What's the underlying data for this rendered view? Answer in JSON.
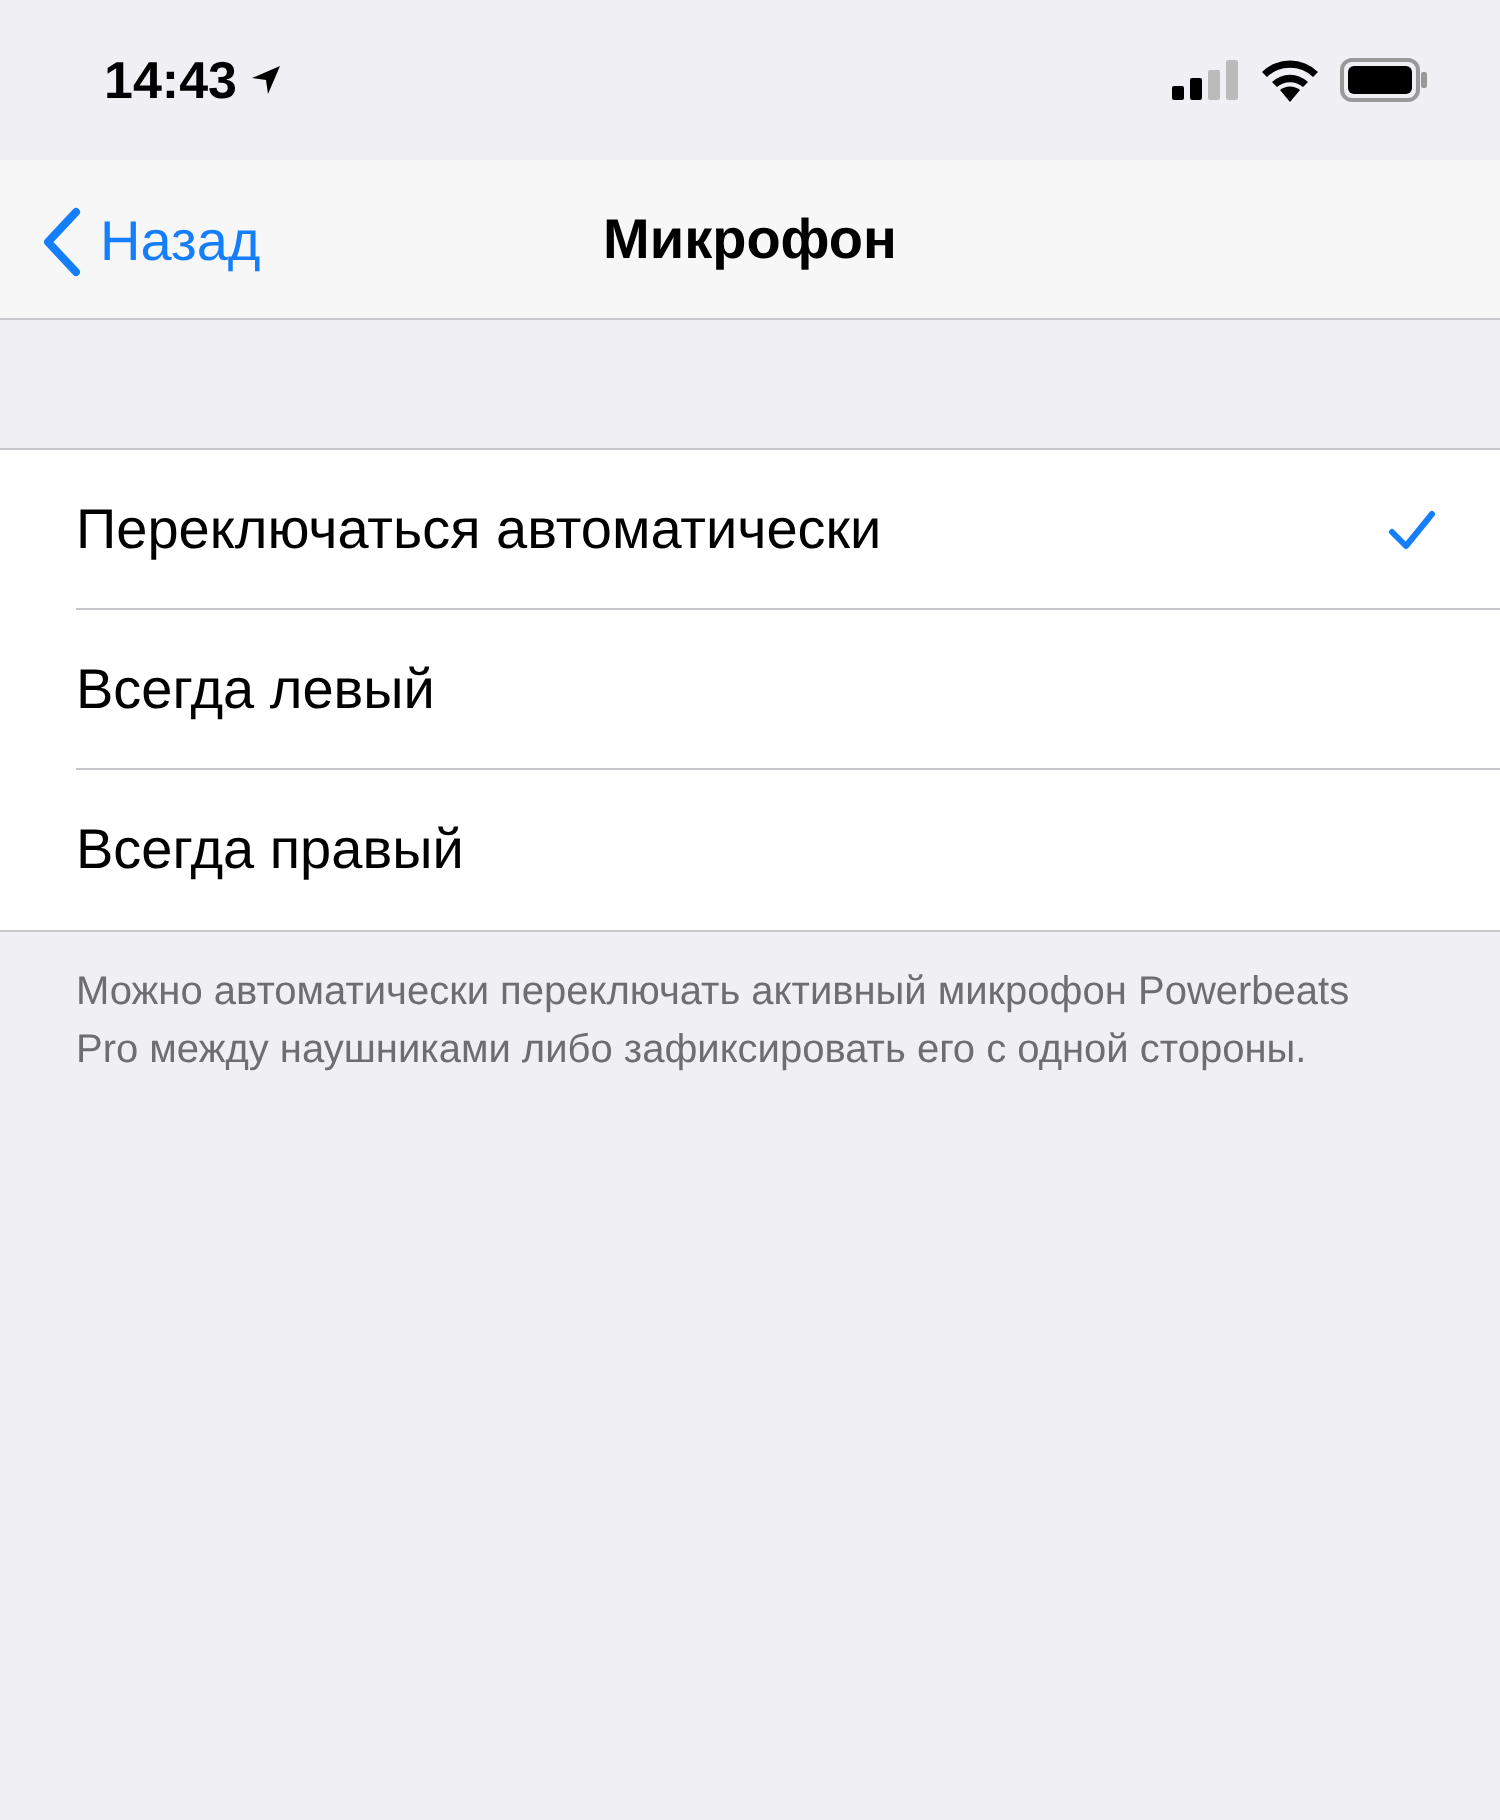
{
  "status_bar": {
    "time": "14:43"
  },
  "nav": {
    "back": "Назад",
    "title": "Микрофон"
  },
  "options": [
    {
      "label": "Переключаться автоматически",
      "selected": true
    },
    {
      "label": "Всегда левый",
      "selected": false
    },
    {
      "label": "Всегда правый",
      "selected": false
    }
  ],
  "footer": "Можно автоматически переключать активный микрофон Powerbeats Pro между наушниками либо зафиксировать его с одной стороны."
}
